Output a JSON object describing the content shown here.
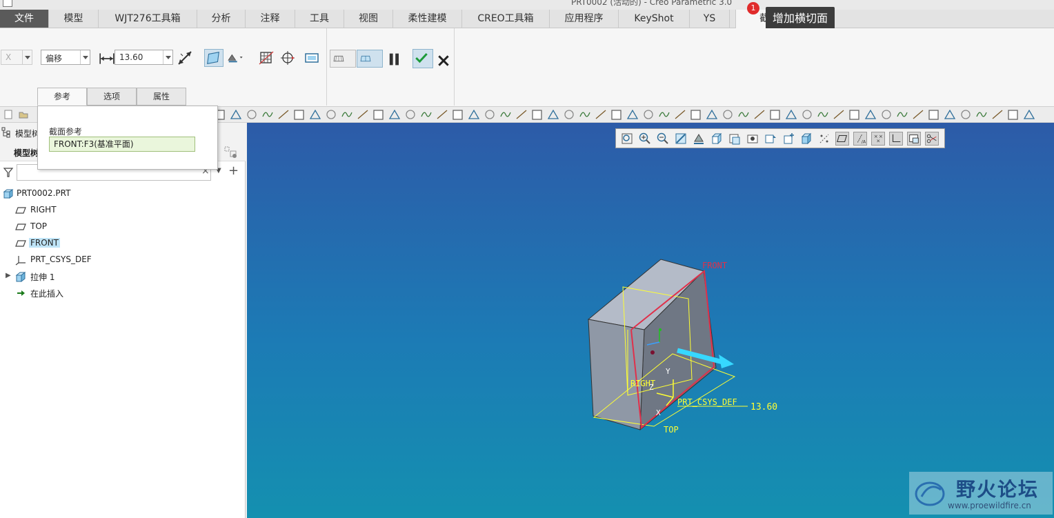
{
  "window": {
    "title": "PRT0002 (活动的) - Creo Parametric 3.0"
  },
  "ribbon_tabs": [
    {
      "label": "文件"
    },
    {
      "label": "模型"
    },
    {
      "label": "WJT276工具箱"
    },
    {
      "label": "分析"
    },
    {
      "label": "注释"
    },
    {
      "label": "工具"
    },
    {
      "label": "视图"
    },
    {
      "label": "柔性建模"
    },
    {
      "label": "CREO工具箱"
    },
    {
      "label": "应用程序"
    },
    {
      "label": "KeyShot"
    },
    {
      "label": "YS"
    },
    {
      "label": "截面"
    }
  ],
  "notification": {
    "count": "1",
    "tooltip": "增加横切面"
  },
  "dashboard": {
    "axis_select": "X",
    "type_select": "偏移",
    "offset_value": "13.60",
    "subtabs": [
      "参考",
      "选项",
      "属性"
    ]
  },
  "ref_panel": {
    "label": "截面参考",
    "value": "FRONT:F3(基准平面)"
  },
  "model_tree": {
    "panel_title": "模型树",
    "sub_title": "模型树",
    "filter_placeholder": "",
    "items": [
      {
        "label": "PRT0002.PRT",
        "icon": "part-icon"
      },
      {
        "label": "RIGHT",
        "icon": "datum-plane-icon"
      },
      {
        "label": "TOP",
        "icon": "datum-plane-icon"
      },
      {
        "label": "FRONT",
        "icon": "datum-plane-icon",
        "selected": true
      },
      {
        "label": "PRT_CSYS_DEF",
        "icon": "csys-icon"
      },
      {
        "label": "拉伸 1",
        "icon": "extrude-icon"
      },
      {
        "label": "在此插入",
        "icon": "insert-here-icon"
      }
    ]
  },
  "viewport": {
    "labels": {
      "front": "FRONT",
      "right": "RIGHT",
      "top": "TOP",
      "csys": "PRT_CSYS_DEF",
      "dim": "13.60",
      "y": "Y",
      "x": "X",
      "z": "Z"
    }
  },
  "watermark": {
    "title": "野火论坛",
    "url": "www.proewildfire.cn"
  },
  "colors": {
    "viewport_top": "#2d5ba8",
    "viewport_bottom": "#1490b0",
    "datum": "#ffff33",
    "section": "#e0304a",
    "arrow": "#36d8ff"
  }
}
